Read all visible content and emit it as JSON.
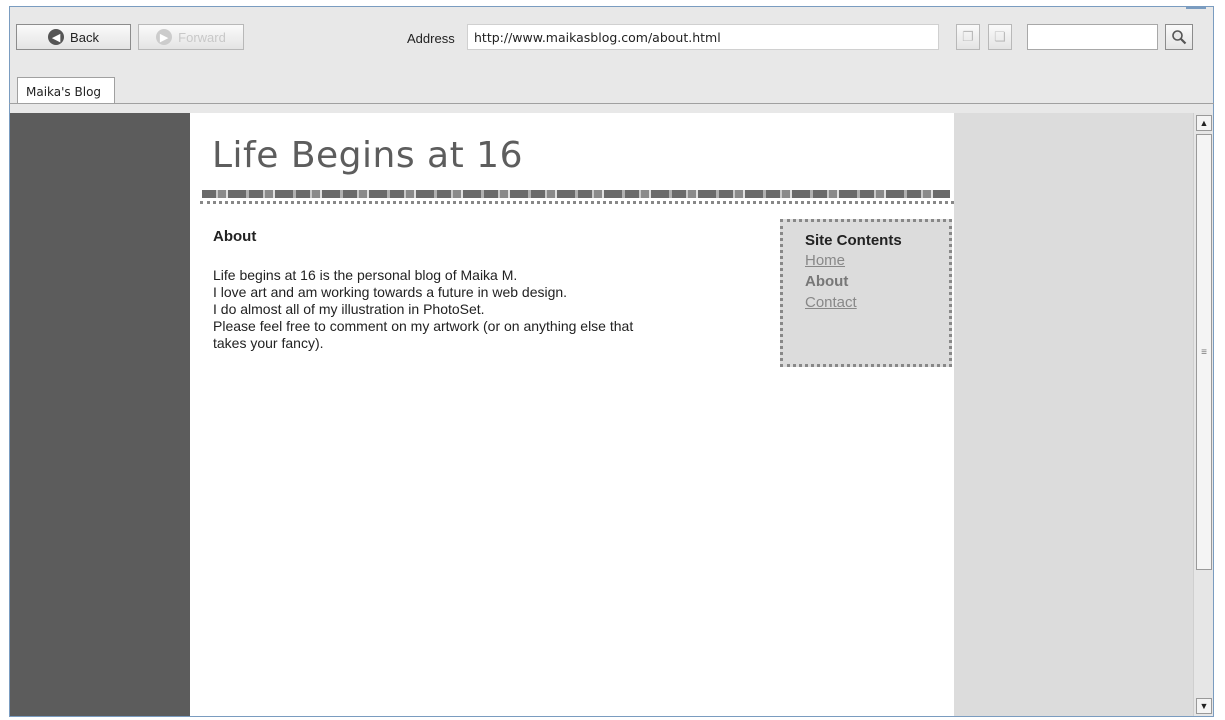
{
  "toolbar": {
    "back_label": "Back",
    "forward_label": "Forward",
    "address_label": "Address",
    "address_value": "http://www.maikasblog.com/about.html",
    "search_value": ""
  },
  "tabs": [
    {
      "label": "Maika's Blog"
    }
  ],
  "page": {
    "site_title": "Life Begins at 16",
    "section_heading": "About",
    "paragraph_lines": [
      "Life begins at 16 is the personal blog of Maika M.",
      "I love art and am working towards a future in web design.",
      "I do almost all of my illustration in PhotoSet.",
      "Please feel free to comment on my artwork (or on anything else that",
      "takes your fancy)."
    ],
    "sidebar": {
      "title": "Site Contents",
      "links": [
        "Home",
        "About",
        "Contact"
      ],
      "current": "About"
    }
  },
  "icons": {
    "back": "back-arrow-icon",
    "forward": "forward-arrow-icon",
    "copy": "copy-icon",
    "paste": "paste-icon",
    "search": "magnifier-icon"
  },
  "colors": {
    "left_band": "#5c5c5c",
    "title_text": "#5d5d5d",
    "link": "#888888",
    "sidebar_bg": "#dcdcdc"
  }
}
